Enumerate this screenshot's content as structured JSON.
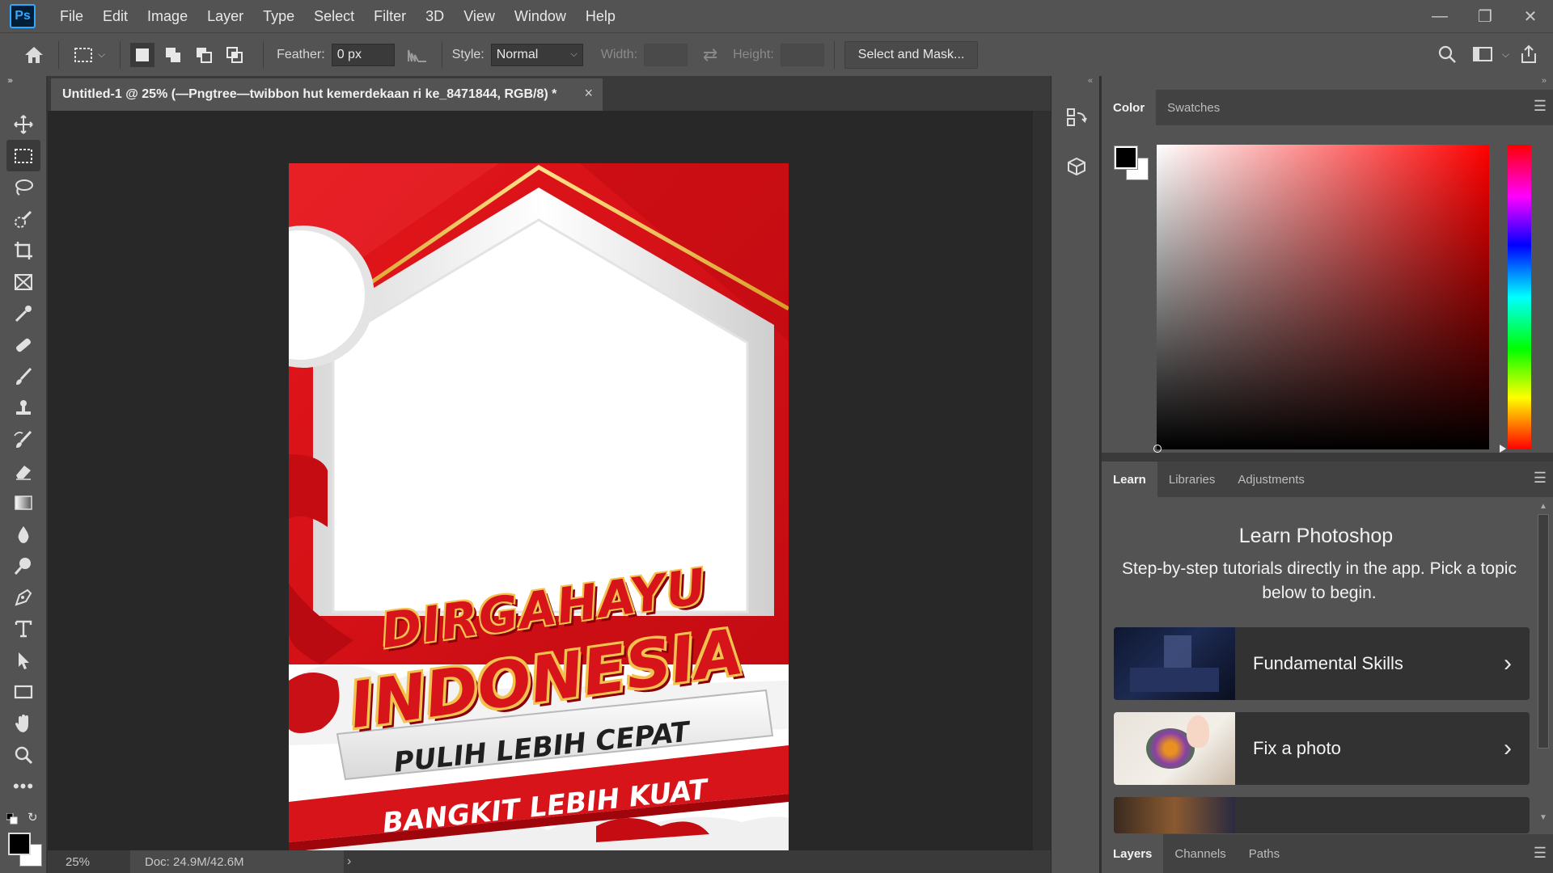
{
  "menubar": {
    "logo": "Ps",
    "items": [
      "File",
      "Edit",
      "Image",
      "Layer",
      "Type",
      "Select",
      "Filter",
      "3D",
      "View",
      "Window",
      "Help"
    ]
  },
  "options": {
    "feather_label": "Feather:",
    "feather_value": "0 px",
    "style_label": "Style:",
    "style_value": "Normal",
    "width_label": "Width:",
    "height_label": "Height:",
    "select_mask_label": "Select and Mask..."
  },
  "document": {
    "tab_title": "Untitled-1 @ 25% (—Pngtree—twibbon hut kemerdekaan ri ke_8471844, RGB/8) *",
    "close_glyph": "×",
    "zoom": "25%",
    "doc_size": "Doc: 24.9M/42.6M"
  },
  "artwork": {
    "line1": "DIRGAHAYU",
    "line2": "INDONESIA",
    "line3": "PULIH LEBIH CEPAT",
    "line4": "BANGKIT LEBIH KUAT"
  },
  "color_panel": {
    "tabs": [
      "Color",
      "Swatches"
    ],
    "foreground": "#000000",
    "background": "#ffffff",
    "hue": "#ff0000"
  },
  "learn_panel": {
    "tabs": [
      "Learn",
      "Libraries",
      "Adjustments"
    ],
    "title": "Learn Photoshop",
    "subtitle": "Step-by-step tutorials directly in the app. Pick a topic below to begin.",
    "cards": [
      {
        "label": "Fundamental Skills"
      },
      {
        "label": "Fix a photo"
      }
    ]
  },
  "layers_panel": {
    "tabs": [
      "Layers",
      "Channels",
      "Paths"
    ]
  },
  "colors": {
    "brand_red": "#d7141a",
    "gold": "#e8b83a"
  }
}
